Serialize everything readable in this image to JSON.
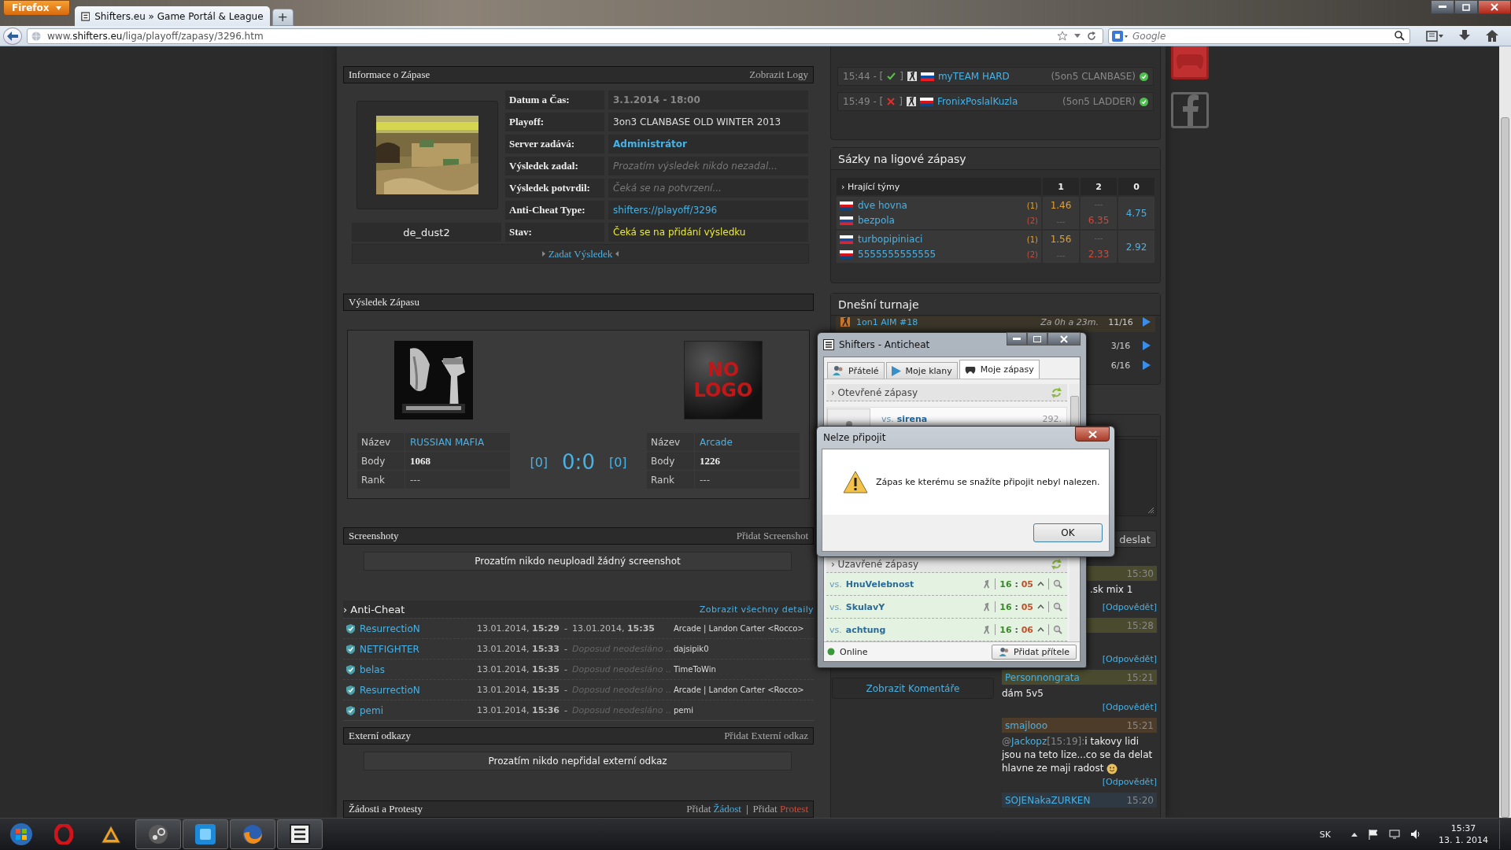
{
  "browser": {
    "menu_button": "Firefox",
    "tab_title": "Shifters.eu » Game Portál & League",
    "new_tab": "+",
    "url": "www.**shifters.eu**/liga/playoff/zapasy/3296.htm",
    "search_placeholder": "Google"
  },
  "match_info": {
    "title": "Informace o Zápase",
    "action": "Zobrazit Logy",
    "map_name": "de_dust2",
    "submit": "Zadat Výsledek",
    "fields": [
      {
        "label": "Datum a Čas:",
        "value": "3.1.2014 - 18:00",
        "kind": "date"
      },
      {
        "label": "Playoff:",
        "value": "3on3 CLANBASE OLD WINTER 2013",
        "kind": "plain"
      },
      {
        "label": "Server zadává:",
        "value": "Administrátor",
        "kind": "link"
      },
      {
        "label": "Výsledek zadal:",
        "value": "Prozatím výsledek nikdo nezadal...",
        "kind": "pending"
      },
      {
        "label": "Výsledek potvrdil:",
        "value": "Čeká se na potvrzení...",
        "kind": "pending"
      },
      {
        "label": "Anti-Cheat Type:",
        "value": "shifters://playoff/3296",
        "kind": "url"
      },
      {
        "label": "Stav:",
        "value": "Čeká se na přidání výsledku",
        "kind": "status"
      }
    ]
  },
  "result": {
    "title": "Výsledek Zápasu",
    "score": "0:0",
    "teams": [
      {
        "kind": "picture",
        "side_score": "[0]",
        "rows": [
          {
            "label": "Název",
            "value": "RUSSIAN MAFIA",
            "kind": "link"
          },
          {
            "label": "Body",
            "value": "1068",
            "kind": "number"
          },
          {
            "label": "Rank",
            "value": "---",
            "kind": "plain"
          }
        ]
      },
      {
        "kind": "placeholder",
        "logo_text": "NO LOGO",
        "side_score": "[0]",
        "rows": [
          {
            "label": "Název",
            "value": "Arcade",
            "kind": "link"
          },
          {
            "label": "Body",
            "value": "1226",
            "kind": "number"
          },
          {
            "label": "Rank",
            "value": "---",
            "kind": "plain"
          }
        ]
      }
    ]
  },
  "screenshots": {
    "title": "Screenshoty",
    "action": "Přidat Screenshot",
    "empty": "Prozatím nikdo neuploadl žádný screenshot"
  },
  "anticheat": {
    "title": "› Anti-Cheat",
    "action": "Zobrazit všechny detaily",
    "rows": [
      {
        "player": "ResurrectioN",
        "start": "13.01.2014, **15:29**",
        "sep": "-",
        "sent": true,
        "end": "13.01.2014, **15:35**",
        "info": "Arcade | Landon Carter <Rocco>"
      },
      {
        "player": "NETFIGHTER",
        "start": "13.01.2014, **15:33**",
        "sep": "-",
        "sent": false,
        "end": "Doposud neodesláno ..",
        "info": "dajsipik0"
      },
      {
        "player": "belas",
        "start": "13.01.2014, **15:35**",
        "sep": "-",
        "sent": false,
        "end": "Doposud neodesláno ..",
        "info": "TimeToWin"
      },
      {
        "player": "ResurrectioN",
        "start": "13.01.2014, **15:35**",
        "sep": "-",
        "sent": false,
        "end": "Doposud neodesláno ..",
        "info": "Arcade | Landon Carter <Rocco>"
      },
      {
        "player": "pemi",
        "start": "13.01.2014, **15:36**",
        "sep": "-",
        "sent": false,
        "end": "Doposud neodesláno ..",
        "info": "pemi"
      }
    ]
  },
  "external_links": {
    "title": "Externí odkazy",
    "action": "Přidat Externí odkaz",
    "empty": "Prozatím nikdo nepřidal externí odkaz"
  },
  "requests": {
    "title": "Žádosti a Protesty",
    "separator": "|",
    "actions": [
      {
        "prefix": "Přidat",
        "link": "Žádost",
        "kind": "request"
      },
      {
        "prefix": "Přidat",
        "link": "Protest",
        "kind": "protest"
      }
    ]
  },
  "live_matches": [
    {
      "time": "15:44 - [",
      "confirmed": true,
      "bracket_end": "]",
      "team": "myTEAM HARD",
      "mode": "(5on5 CLANBASE)",
      "online": true
    },
    {
      "time": "15:49 - [",
      "confirmed": false,
      "bracket_end": "]",
      "team": "FronixPoslalKuzla",
      "mode": "(5on5 LADDER)",
      "online": true
    }
  ],
  "bets": {
    "title": "Sázky na ligové zápasy",
    "team_header": "› Hrající týmy",
    "columns": [
      "1",
      "2",
      "0"
    ],
    "matches": [
      {
        "teams": [
          {
            "name": "dve hovna",
            "slot": "(1)"
          },
          {
            "name": "bezpola",
            "slot": "(2)"
          }
        ],
        "odds_1": [
          "1.46",
          "---"
        ],
        "odds_2": [
          "---",
          "6.35"
        ],
        "odds_0": "4.75"
      },
      {
        "teams": [
          {
            "name": "turbopipiniaci",
            "slot": "(1)"
          },
          {
            "name": "5555555555555",
            "slot": "(2)"
          }
        ],
        "odds_1": [
          "1.56",
          "---"
        ],
        "odds_2": [
          "---",
          "2.33"
        ],
        "odds_0": "2.92"
      }
    ]
  },
  "tournaments": {
    "title": "Dnešní turnaje",
    "rows": [
      {
        "name": "1on1 AIM #18",
        "starts": "Za 0h a 23m.",
        "slots": "11/16"
      },
      {
        "slots": "3/16"
      },
      {
        "slots": "6/16"
      }
    ]
  },
  "comments": {
    "show_button": "Zobrazit Komentáře",
    "send_button": "deslat",
    "messages": [
      {
        "kind": "partial",
        "color": "#4a4a2e",
        "time": "15:30",
        "text": ".sk mix 1",
        "reply": "[Odpovědět]"
      },
      {
        "kind": "partial",
        "color": "#4a4a2e",
        "time": "15:28",
        "reply": "[Odpovědět]"
      },
      {
        "kind": "full",
        "color": "#4a4a2e",
        "author": "Personnongrata",
        "time": "15:21",
        "text": "dám 5v5",
        "reply": "[Odpovědět]"
      },
      {
        "kind": "full",
        "color": "#4d3c2a",
        "author": "smajlooo",
        "time": "15:21",
        "mention_prefix": "@",
        "mention": "Jackopz",
        "mention_time": "[15:19]:",
        "text": "i takovy lidi jsou na teto lize...co se da delat hlavne ze maji radost",
        "emoji": true,
        "reply": "[Odpovědět]"
      },
      {
        "kind": "full",
        "color": "#2e3944",
        "author": "SOJENakaZURKEN",
        "time": "15:20"
      }
    ]
  },
  "anticheat_window": {
    "title": "Shifters - Anticheat",
    "tabs": [
      {
        "label": "Přátelé",
        "kind": "friends",
        "selected": false
      },
      {
        "label": "Moje klany",
        "kind": "clans",
        "selected": false
      },
      {
        "label": "Moje zápasy",
        "kind": "matches",
        "selected": true
      }
    ],
    "open_section": "› Otevřené zápasy",
    "open_matches": [
      {
        "vs": "vs.",
        "opponent": "sirena",
        "count": "292."
      }
    ],
    "closed_section": "› Uzavřené zápasy",
    "closed_matches": [
      {
        "vs": "vs.",
        "opponent": "HnuVelebnost",
        "score_a": "16",
        "score_sep": ":",
        "score_b": "05"
      },
      {
        "vs": "vs.",
        "opponent": "SkulavY",
        "score_a": "16",
        "score_sep": ":",
        "score_b": "05"
      },
      {
        "vs": "vs.",
        "opponent": "achtung",
        "score_a": "16",
        "score_sep": ":",
        "score_b": "06"
      }
    ],
    "status": "Online",
    "online": true,
    "add_friend": "Přidat přítele"
  },
  "dialog": {
    "title": "Nelze připojit",
    "message": "Zápas ke kterému se snažíte připojit nebyl nalezen.",
    "ok": "OK"
  },
  "taskbar": {
    "apps": [
      {
        "kind": "opera",
        "running": false
      },
      {
        "kind": "triangle",
        "running": false
      },
      {
        "kind": "steam",
        "running": true
      },
      {
        "kind": "square",
        "running": true
      },
      {
        "kind": "firefox",
        "running": true
      },
      {
        "kind": "shifters",
        "running": true
      }
    ],
    "language": "SK",
    "time": "15:37",
    "date": "13. 1. 2014"
  }
}
